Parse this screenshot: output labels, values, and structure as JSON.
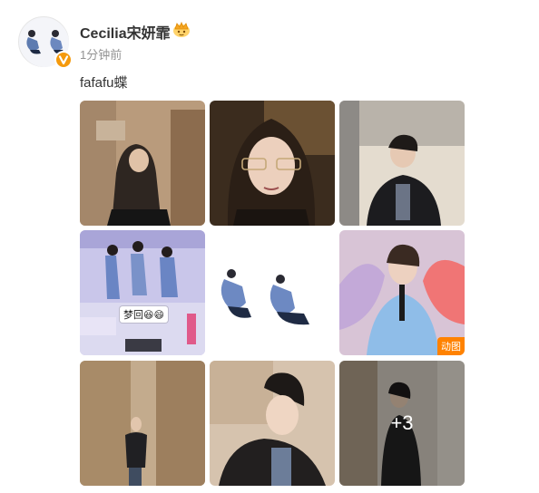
{
  "post": {
    "author": "Cecilia宋妍霏",
    "timestamp": "1分钟前",
    "text": "fafafu蝶"
  },
  "icons": {
    "avatar": "avatar-image",
    "verified": "verified-v-icon",
    "crown": "crown-badge-icon"
  },
  "colors": {
    "verified_badge": "#f59a0c",
    "gif_badge": "#ff8200",
    "timestamp_text": "#939393"
  },
  "images": [
    {
      "id": "photo-1",
      "kind": "photo"
    },
    {
      "id": "photo-2",
      "kind": "photo"
    },
    {
      "id": "photo-3",
      "kind": "photo"
    },
    {
      "id": "photo-4",
      "kind": "photo",
      "caption": "梦回😆😄"
    },
    {
      "id": "photo-5",
      "kind": "photo"
    },
    {
      "id": "photo-6",
      "kind": "gif",
      "badge": "动图"
    },
    {
      "id": "photo-7",
      "kind": "photo"
    },
    {
      "id": "photo-8",
      "kind": "photo"
    },
    {
      "id": "photo-9",
      "kind": "photo",
      "more_label": "+3"
    }
  ]
}
